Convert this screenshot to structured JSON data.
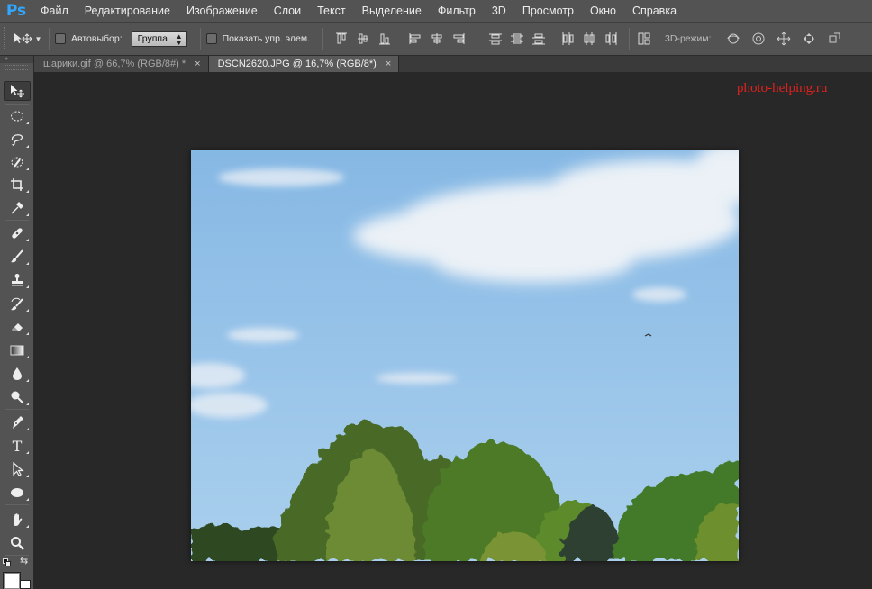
{
  "app": {
    "logo": "Ps",
    "menu": [
      "Файл",
      "Редактирование",
      "Изображение",
      "Слои",
      "Текст",
      "Выделение",
      "Фильтр",
      "3D",
      "Просмотр",
      "Окно",
      "Справка"
    ]
  },
  "options": {
    "auto_select_label": "Автовыбор:",
    "auto_select_checked": false,
    "target_value": "Группа",
    "show_transform_label": "Показать упр. элем.",
    "show_transform_checked": false,
    "mode3d_label": "3D-режим:"
  },
  "tabs": [
    {
      "label": "шарики.gif @ 66,7% (RGB/8#) *",
      "close": "×",
      "active": false
    },
    {
      "label": "DSCN2620.JPG @ 16,7% (RGB/8*)",
      "close": "×",
      "active": true
    }
  ],
  "toolbar": {
    "tools": [
      "move-tool",
      "elliptical-marquee-tool",
      "lasso-tool",
      "quick-selection-tool",
      "crop-tool",
      "eyedropper-tool",
      "spot-healing-brush-tool",
      "brush-tool",
      "clone-stamp-tool",
      "history-brush-tool",
      "eraser-tool",
      "gradient-tool",
      "blur-tool",
      "dodge-tool",
      "pen-tool",
      "type-tool",
      "path-selection-tool",
      "ellipse-tool",
      "hand-tool",
      "zoom-tool"
    ],
    "type_glyph": "T",
    "foreground_color": "#ffffff",
    "background_color": "#ffffff"
  },
  "workspace": {
    "watermark": "photo-helping.ru",
    "watermark_color": "#e0221f",
    "canvas_background": "#282828"
  },
  "colors": {
    "ui_panel": "#535353",
    "ps_blue": "#31a8ff",
    "sky_top": "#8cbde6",
    "sky_bottom": "#a5cbea"
  }
}
